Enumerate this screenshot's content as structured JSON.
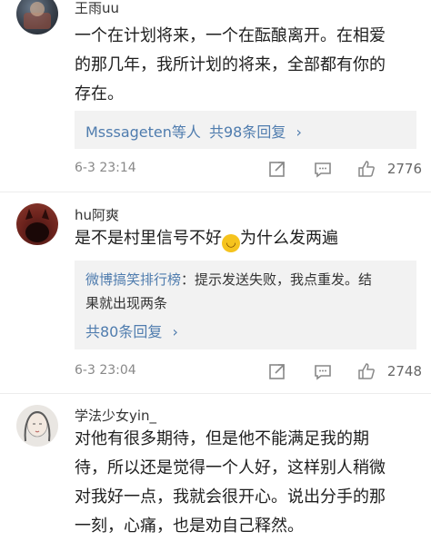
{
  "comments": [
    {
      "username": "王雨uu",
      "lines": [
        "一个在计划将来，一个在酝酿离开。在相爱",
        "的那几年，我所计划的将来，全部都有你的",
        "存在。"
      ],
      "reply_summary": {
        "users": "Msssageten等人",
        "link": "共98条回复",
        "arrow": "›"
      },
      "time": "6-3 23:14",
      "likes": "2776"
    },
    {
      "username": "hu阿爽",
      "text_before": "是不是村里信号不好",
      "emoji": "😅",
      "text_after": "为什么发两遍",
      "reply_preview": {
        "author": "微博搞笑排行榜",
        "line1": "：提示发送失败，我点重发。结",
        "line2": "果就出现两条",
        "link": "共80条回复",
        "arrow": "›"
      },
      "time": "6-3 23:04",
      "likes": "2748"
    },
    {
      "username": "学法少女yin_",
      "lines": [
        "对他有很多期待，但是他不能满足我的期",
        "待，所以还是觉得一个人好，这样别人稍微",
        "对我好一点，我就会很开心。说出分手的那",
        "一刻，心痛，也是劝自己释然。"
      ]
    }
  ],
  "icons": {
    "share": "share-icon",
    "comment": "comment-icon",
    "like": "like-icon"
  },
  "colors": {
    "link": "#4f7cae",
    "reply_bg": "#f2f2f2",
    "meta": "#888888"
  }
}
